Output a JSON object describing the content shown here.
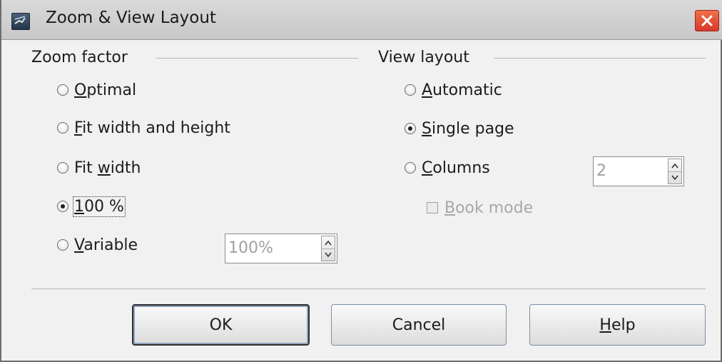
{
  "window": {
    "title": "Zoom & View Layout",
    "icons": {
      "app": "app-icon",
      "close": "close-icon"
    },
    "colors": {
      "close_button": "#d7382a",
      "title_bar": "#c8c8c8",
      "dialog_bg": "#f1f1f1",
      "disabled_text": "#a0a0a0"
    }
  },
  "zoom": {
    "section_title": "Zoom factor",
    "options": [
      {
        "label": "Optimal",
        "checked": false
      },
      {
        "label": "Fit width and height",
        "checked": false
      },
      {
        "label": "Fit width",
        "checked": false
      },
      {
        "label": "100 %",
        "checked": true
      },
      {
        "label": "Variable",
        "checked": false
      }
    ],
    "variable_value": "100%"
  },
  "view": {
    "section_title": "View layout",
    "options": [
      {
        "label": "Automatic",
        "checked": false
      },
      {
        "label": "Single page",
        "checked": true
      },
      {
        "label": "Columns",
        "checked": false
      }
    ],
    "columns_value": "2",
    "book_mode_label": "Book mode",
    "book_mode_checked": false
  },
  "buttons": {
    "ok": "OK",
    "cancel": "Cancel",
    "help": "Help"
  }
}
